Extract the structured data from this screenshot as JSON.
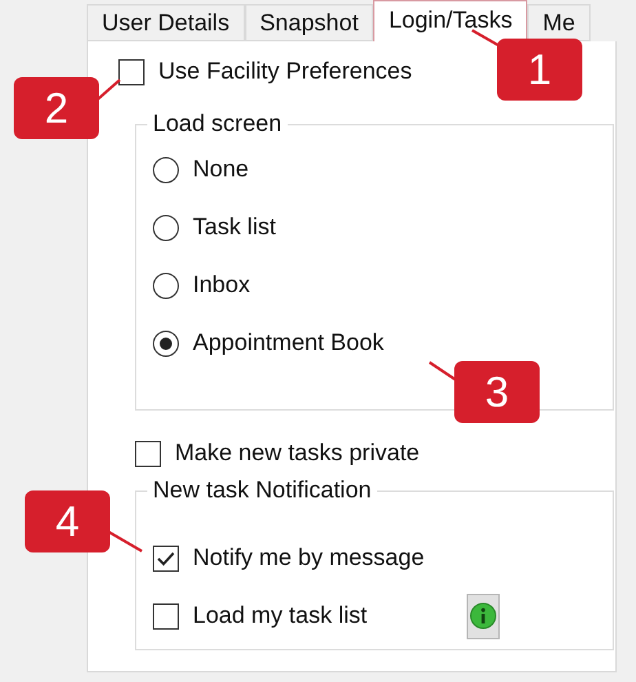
{
  "tabs": [
    {
      "label": "User Details",
      "selected": false
    },
    {
      "label": "Snapshot",
      "selected": false
    },
    {
      "label": "Login/Tasks",
      "selected": true
    },
    {
      "label": "Me",
      "selected": false
    }
  ],
  "use_facility_preferences": {
    "label": "Use Facility Preferences",
    "checked": false
  },
  "load_screen": {
    "title": "Load screen",
    "options": [
      {
        "label": "None",
        "selected": false
      },
      {
        "label": "Task list",
        "selected": false
      },
      {
        "label": "Inbox",
        "selected": false
      },
      {
        "label": "Appointment Book",
        "selected": true
      }
    ]
  },
  "make_private": {
    "label": "Make new tasks private",
    "checked": false
  },
  "notification": {
    "title": "New task Notification",
    "options": [
      {
        "label": "Notify me by message",
        "checked": true
      },
      {
        "label": "Load my task list",
        "checked": false
      }
    ]
  },
  "callouts": [
    {
      "label": "1"
    },
    {
      "label": "2"
    },
    {
      "label": "3"
    },
    {
      "label": "4"
    }
  ]
}
